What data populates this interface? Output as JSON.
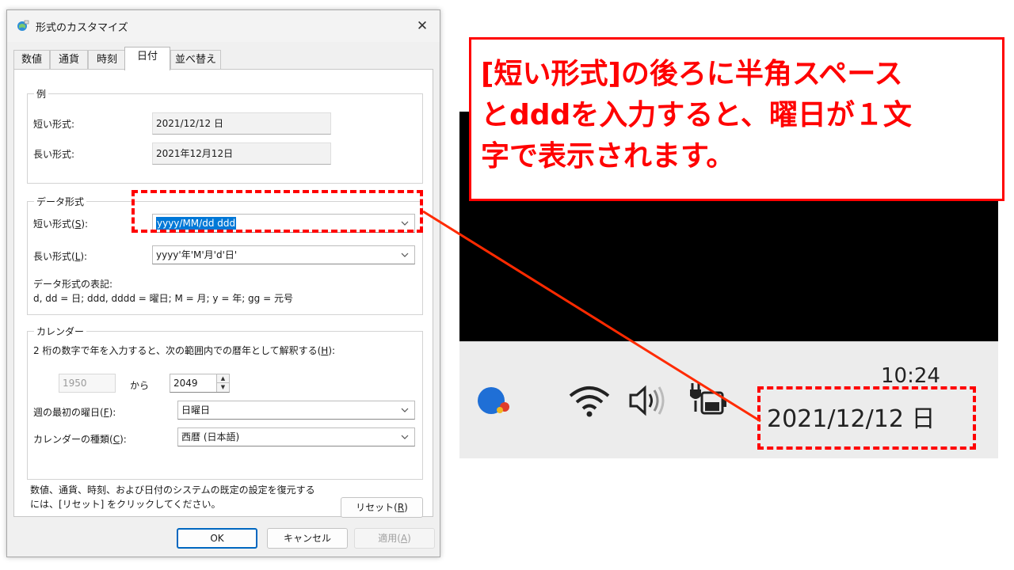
{
  "dialog": {
    "title": "形式のカスタマイズ",
    "close": "✕",
    "tabs": [
      {
        "label": "数値"
      },
      {
        "label": "通貨"
      },
      {
        "label": "時刻"
      },
      {
        "label": "日付"
      },
      {
        "label": "並べ替え"
      }
    ],
    "example": {
      "group": "例",
      "short_label": "短い形式:",
      "short_value": "2021/12/12 日",
      "long_label": "長い形式:",
      "long_value": "2021年12月12日"
    },
    "format": {
      "group": "データ形式",
      "short_label": "短い形式(",
      "short_key": "S",
      "short_value": "yyyy/MM/dd ddd",
      "long_label": "長い形式(",
      "long_key": "L",
      "long_value": "yyyy'年'M'月'd'日'",
      "notation_title": "データ形式の表記:",
      "notation": "d, dd = 日;  ddd, dddd = 曜日; M = 月; y = 年; gg = 元号"
    },
    "calendar": {
      "group": "カレンダー",
      "desc": "2 桁の数字で年を入力すると、次の範囲内での暦年として解釈する(",
      "desc_key": "H",
      "from_value": "1950",
      "to_label": "から",
      "to_value": "2049",
      "firstday_label": "週の最初の曜日(",
      "firstday_key": "F",
      "firstday_value": "日曜日",
      "type_label": "カレンダーの種類(",
      "type_key": "C",
      "type_value": "西暦 (日本語)"
    },
    "reset_note_1": "数値、通貨、時刻、および日付のシステムの既定の設定を復元する",
    "reset_note_2": "には、[リセット] をクリックしてください。",
    "reset_button": "リセット(",
    "reset_key": "R",
    "ok": "OK",
    "cancel": "キャンセル",
    "apply": "適用(",
    "apply_key": "A"
  },
  "callout": {
    "line1": "[短い形式]の後ろに半角スペース",
    "line2": "とdddを入力すると、曜日が１文",
    "line3": "字で表示されます。"
  },
  "taskbar": {
    "time": "10:24",
    "date": "2021/12/12 日"
  },
  "colors": {
    "accent": "#ff0000",
    "selection": "#0078d7",
    "primary_button_border": "#0067c0"
  },
  "icons": [
    "app-icon",
    "close-icon",
    "chevron-down-icon",
    "spin-up-icon",
    "spin-down-icon",
    "assistant-icon",
    "wifi-icon",
    "speaker-icon",
    "battery-plug-icon"
  ]
}
